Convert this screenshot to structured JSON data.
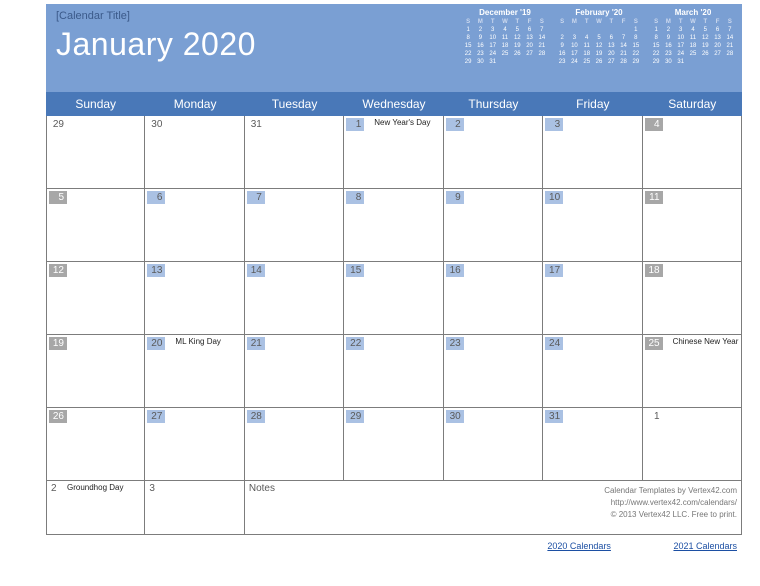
{
  "header": {
    "subtitle": "[Calendar Title]",
    "title": "January 2020"
  },
  "miniCalendars": [
    {
      "title": "December '19",
      "leading": 0,
      "days": 31
    },
    {
      "title": "February '20",
      "leading": 6,
      "days": 29
    },
    {
      "title": "March '20",
      "leading": 0,
      "days": 31
    }
  ],
  "miniDow": [
    "S",
    "M",
    "T",
    "W",
    "T",
    "F",
    "S"
  ],
  "dayHeaders": [
    "Sunday",
    "Monday",
    "Tuesday",
    "Wednesday",
    "Thursday",
    "Friday",
    "Saturday"
  ],
  "weeks": [
    [
      {
        "n": "29",
        "cls": "",
        "ev": ""
      },
      {
        "n": "30",
        "cls": "",
        "ev": ""
      },
      {
        "n": "31",
        "cls": "",
        "ev": ""
      },
      {
        "n": "1",
        "cls": "blue",
        "ev": "New Year's Day"
      },
      {
        "n": "2",
        "cls": "blue",
        "ev": ""
      },
      {
        "n": "3",
        "cls": "blue",
        "ev": ""
      },
      {
        "n": "4",
        "cls": "grey",
        "ev": ""
      }
    ],
    [
      {
        "n": "5",
        "cls": "grey",
        "ev": ""
      },
      {
        "n": "6",
        "cls": "blue",
        "ev": ""
      },
      {
        "n": "7",
        "cls": "blue",
        "ev": ""
      },
      {
        "n": "8",
        "cls": "blue",
        "ev": ""
      },
      {
        "n": "9",
        "cls": "blue",
        "ev": ""
      },
      {
        "n": "10",
        "cls": "blue",
        "ev": ""
      },
      {
        "n": "11",
        "cls": "grey",
        "ev": ""
      }
    ],
    [
      {
        "n": "12",
        "cls": "grey",
        "ev": ""
      },
      {
        "n": "13",
        "cls": "blue",
        "ev": ""
      },
      {
        "n": "14",
        "cls": "blue",
        "ev": ""
      },
      {
        "n": "15",
        "cls": "blue",
        "ev": ""
      },
      {
        "n": "16",
        "cls": "blue",
        "ev": ""
      },
      {
        "n": "17",
        "cls": "blue",
        "ev": ""
      },
      {
        "n": "18",
        "cls": "grey",
        "ev": ""
      }
    ],
    [
      {
        "n": "19",
        "cls": "grey",
        "ev": ""
      },
      {
        "n": "20",
        "cls": "blue",
        "ev": "ML King Day"
      },
      {
        "n": "21",
        "cls": "blue",
        "ev": ""
      },
      {
        "n": "22",
        "cls": "blue",
        "ev": ""
      },
      {
        "n": "23",
        "cls": "blue",
        "ev": ""
      },
      {
        "n": "24",
        "cls": "blue",
        "ev": ""
      },
      {
        "n": "25",
        "cls": "grey",
        "ev": "Chinese New Year"
      }
    ],
    [
      {
        "n": "26",
        "cls": "grey",
        "ev": ""
      },
      {
        "n": "27",
        "cls": "blue",
        "ev": ""
      },
      {
        "n": "28",
        "cls": "blue",
        "ev": ""
      },
      {
        "n": "29",
        "cls": "blue",
        "ev": ""
      },
      {
        "n": "30",
        "cls": "blue",
        "ev": ""
      },
      {
        "n": "31",
        "cls": "blue",
        "ev": ""
      },
      {
        "n": "1",
        "cls": "",
        "ev": ""
      }
    ]
  ],
  "bottomRow": {
    "cells": [
      {
        "n": "2",
        "ev": "Groundhog Day"
      },
      {
        "n": "3",
        "ev": ""
      }
    ],
    "notesLabel": "Notes",
    "credits": {
      "line1": "Calendar Templates by Vertex42.com",
      "line2": "http://www.vertex42.com/calendars/",
      "line3": "© 2013 Vertex42 LLC. Free to print."
    }
  },
  "links": {
    "a": "2020 Calendars",
    "b": "2021 Calendars"
  }
}
